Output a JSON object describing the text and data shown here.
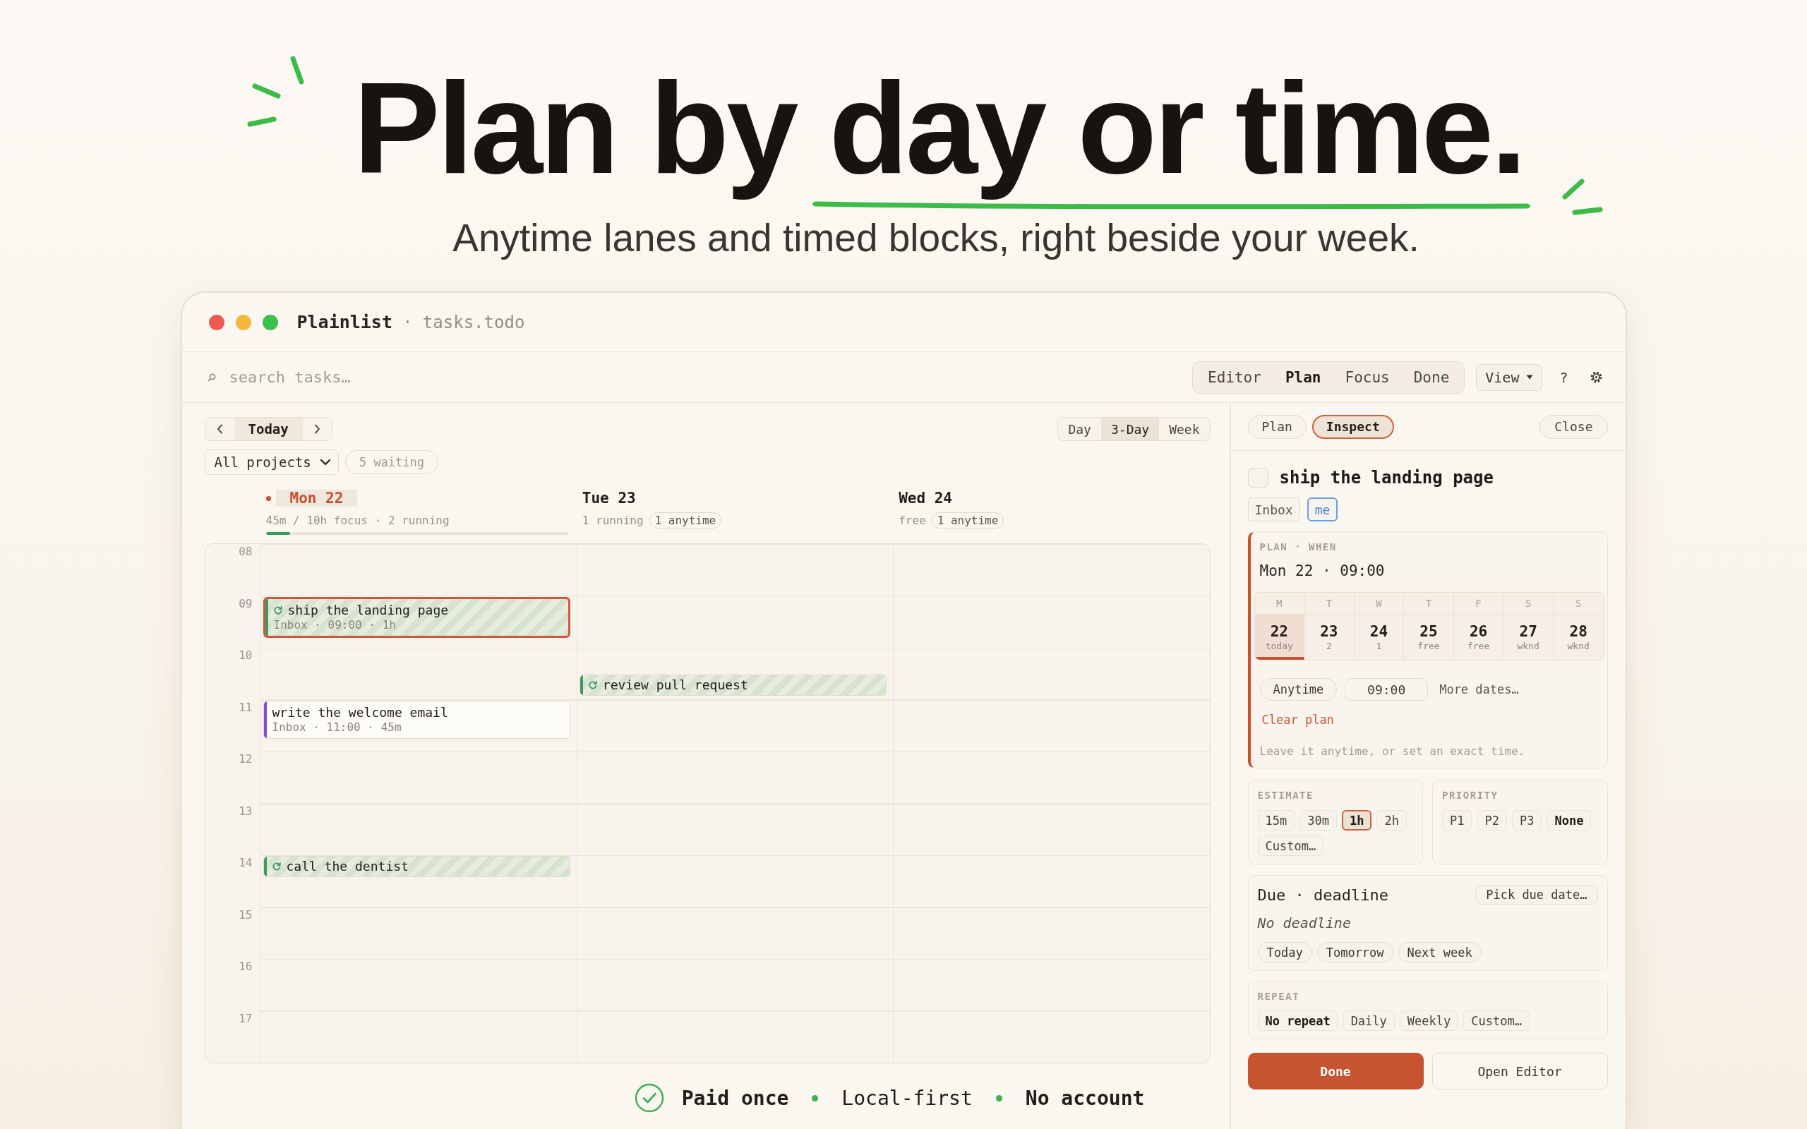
{
  "hero": {
    "headline": "Plan by day or time.",
    "subtitle": "Anytime lanes and timed blocks, right beside your week."
  },
  "window": {
    "title": "Plainlist",
    "subtitle": "· tasks.todo"
  },
  "toolbar": {
    "search": {
      "placeholder": "search tasks…"
    },
    "modes": [
      {
        "label": "Editor",
        "selected": false
      },
      {
        "label": "Plan",
        "selected": true
      },
      {
        "label": "Focus",
        "selected": false
      },
      {
        "label": "Done",
        "selected": false
      }
    ],
    "view_menu": "View",
    "help": "?"
  },
  "calendar": {
    "today_button": "Today",
    "views": [
      {
        "label": "Day",
        "selected": false
      },
      {
        "label": "3-Day",
        "selected": true
      },
      {
        "label": "Week",
        "selected": false
      }
    ],
    "project_filter": "All projects",
    "waiting": "5 waiting",
    "hours": [
      "08",
      "09",
      "10",
      "11",
      "12",
      "13",
      "14",
      "15",
      "16",
      "17"
    ],
    "days": [
      {
        "label": "Mon 22",
        "today": true,
        "summary": "45m / 10h focus · 2 running",
        "level": 0.08,
        "timeline": [
          {
            "kind": "free"
          },
          {
            "kind": "running",
            "title": "ship the landing page",
            "meta": "Inbox · 09:00 · 1h",
            "color": "#3d9a5c",
            "selected": true,
            "half_past": false
          },
          {
            "kind": "free"
          },
          {
            "kind": "timed",
            "title": "write the welcome email",
            "meta": "Inbox · 11:00 · 45m",
            "color": "#7c4ddb",
            "selected": false,
            "half_past": false
          },
          {
            "kind": "free"
          },
          {
            "kind": "free"
          },
          {
            "kind": "running",
            "title": "call the dentist",
            "color": "#3d9a5c",
            "selected": false,
            "half_past": false
          }
        ]
      },
      {
        "label": "Tue 23",
        "today": false,
        "summary": "1 running",
        "anytime": "1 anytime",
        "timeline": [
          {
            "kind": "free"
          },
          {
            "kind": "free"
          },
          {
            "kind": "running",
            "title": "review pull request",
            "color": "#3d9a5c",
            "selected": false,
            "half_past": true
          }
        ]
      },
      {
        "label": "Wed 24",
        "today": false,
        "summary": "free",
        "anytime": "1 anytime"
      }
    ]
  },
  "inspector": {
    "tabs": [
      {
        "label": "Plan",
        "selected": false
      },
      {
        "label": "Inspect",
        "selected": true
      }
    ],
    "close": "Close",
    "task": {
      "checked": false,
      "title": "ship the landing page",
      "tags": [
        {
          "label": "Inbox",
          "kind": "project"
        },
        {
          "label": "me",
          "kind": "assignee"
        }
      ]
    },
    "plan": {
      "label": "PLAN · WHEN",
      "value": "Mon 22 · 09:00",
      "week": [
        {
          "weekday": "M",
          "date": "22",
          "note": "today",
          "selected": true
        },
        {
          "weekday": "T",
          "date": "23",
          "note": "2",
          "selected": false
        },
        {
          "weekday": "W",
          "date": "24",
          "note": "1",
          "selected": false
        },
        {
          "weekday": "T",
          "date": "25",
          "note": "free",
          "selected": false
        },
        {
          "weekday": "F",
          "date": "26",
          "note": "free",
          "selected": false
        },
        {
          "weekday": "S",
          "date": "27",
          "note": "wknd",
          "selected": false
        },
        {
          "weekday": "S",
          "date": "28",
          "note": "wknd",
          "selected": false
        }
      ],
      "anytime_button": "Anytime",
      "time": "09:00",
      "more_dates": "More dates…",
      "clear": "Clear plan",
      "hint": "Leave it anytime, or set an exact time."
    },
    "estimate": {
      "label": "ESTIMATE",
      "kind": "accent",
      "options": [
        {
          "label": "15m",
          "selected": false
        },
        {
          "label": "30m",
          "selected": false
        },
        {
          "label": "1h",
          "selected": true
        },
        {
          "label": "2h",
          "selected": false
        },
        {
          "label": "Custom…",
          "selected": false
        }
      ]
    },
    "priority": {
      "label": "PRIORITY",
      "kind": "plain",
      "options": [
        {
          "label": "P1",
          "selected": false
        },
        {
          "label": "P2",
          "selected": false
        },
        {
          "label": "P3",
          "selected": false
        },
        {
          "label": "None",
          "selected": true
        }
      ]
    },
    "due": {
      "title": "Due · deadline",
      "pick_button": "Pick due date…",
      "value": "No deadline",
      "shortcuts": [
        "Today",
        "Tomorrow",
        "Next week"
      ]
    },
    "repeat": {
      "label": "REPEAT",
      "kind": "plain",
      "options": [
        {
          "label": "No repeat",
          "selected": true
        },
        {
          "label": "Daily",
          "selected": false
        },
        {
          "label": "Weekly",
          "selected": false
        },
        {
          "label": "Custom…",
          "selected": false
        }
      ]
    },
    "actions": [
      {
        "label": "Done",
        "kind": "primary"
      },
      {
        "label": "Open Editor",
        "kind": "secondary"
      }
    ]
  },
  "footer": {
    "items": [
      {
        "text": "Paid once",
        "emphasized": true
      },
      {
        "text": "Local-first",
        "emphasized": false
      },
      {
        "text": "No account",
        "emphasized": true
      }
    ]
  }
}
